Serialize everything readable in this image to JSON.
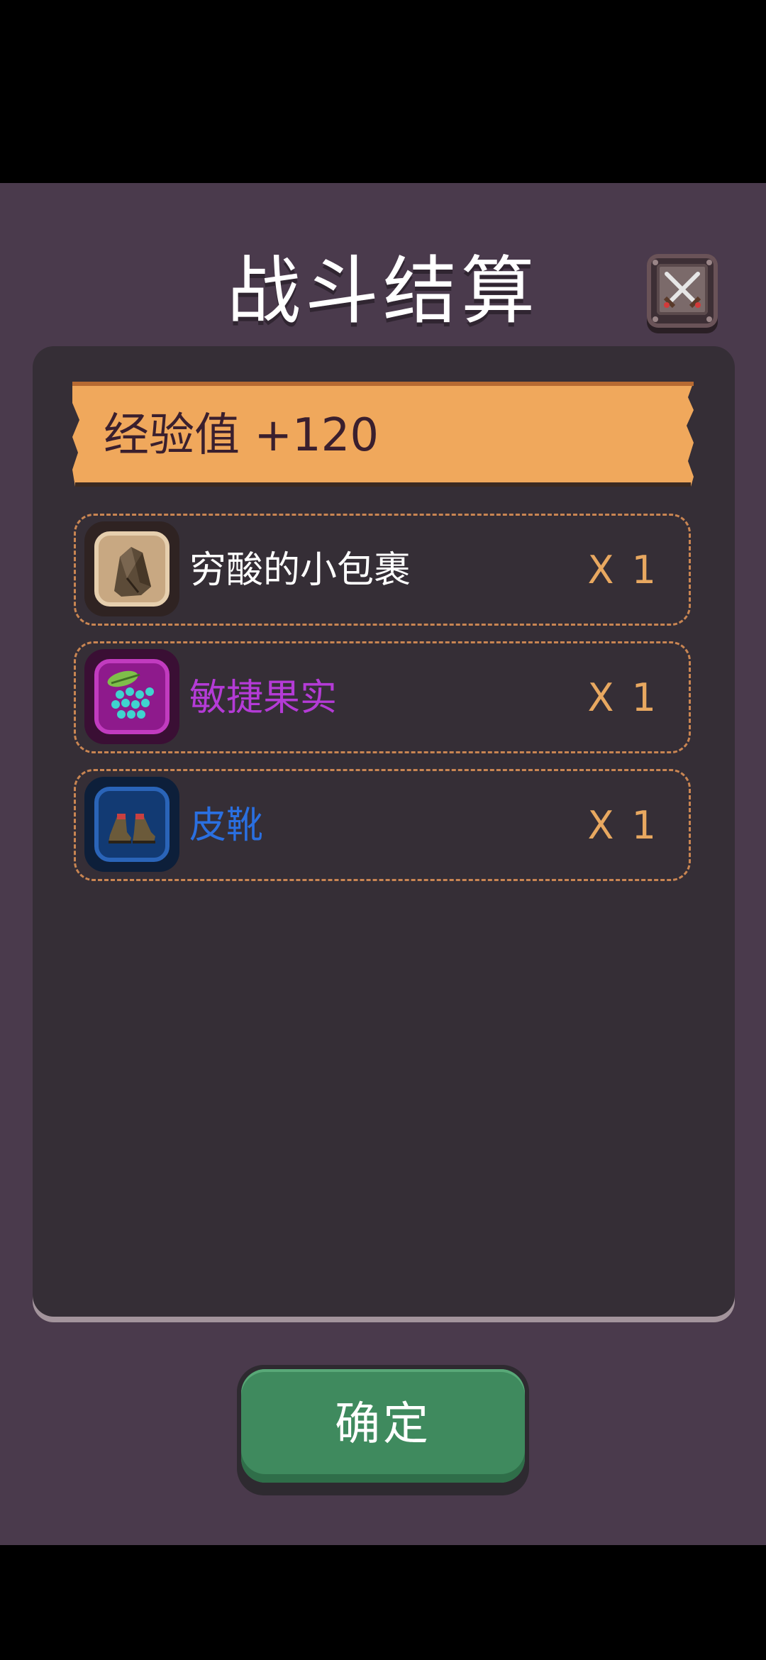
{
  "header": {
    "title": "战斗结算",
    "battle_icon": "crossed-swords-icon"
  },
  "experience": {
    "label": "经验值 +120",
    "banner_color": "#f0a85c"
  },
  "rewards": [
    {
      "name": "穷酸的小包裹",
      "quantity": "X 1",
      "icon": "bundle-icon",
      "name_color": "#ffffff",
      "rarity_color": "#c8a882"
    },
    {
      "name": "敏捷果实",
      "quantity": "X 1",
      "icon": "berry-icon",
      "name_color": "#b43bd6",
      "rarity_color": "#8e1a8c"
    },
    {
      "name": "皮靴",
      "quantity": "X 1",
      "icon": "boots-icon",
      "name_color": "#2a6fe0",
      "rarity_color": "#1a4a96"
    }
  ],
  "footer": {
    "confirm_label": "确定",
    "button_color": "#3f8a5e"
  }
}
